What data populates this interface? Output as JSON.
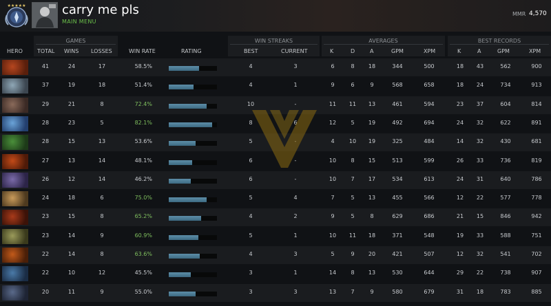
{
  "player": {
    "name": "carry me pls",
    "subtitle": "MAIN MENU",
    "mmr_label": "MMR",
    "mmr_value": "4,570"
  },
  "groups": {
    "games": "GAMES",
    "win_streaks": "WIN STREAKS",
    "averages": "AVERAGES",
    "best_records": "BEST RECORDS"
  },
  "columns": {
    "hero": "HERO",
    "total": "TOTAL",
    "wins": "WINS",
    "losses": "LOSSES",
    "win_rate": "WIN RATE",
    "rating": "RATING",
    "best": "BEST",
    "current": "CURRENT",
    "avg_k": "K",
    "avg_d": "D",
    "avg_a": "A",
    "avg_gpm": "GPM",
    "avg_xpm": "XPM",
    "best_k": "K",
    "best_a": "A",
    "best_gpm": "GPM",
    "best_xpm": "XPM"
  },
  "colors": {
    "win_rate_high": "#7fbf5e",
    "win_rate_low": "#c9ccd0",
    "rating_fill": "#4e7d96",
    "mmr_accent": "#6bbf4a"
  },
  "rows": [
    {
      "total": "41",
      "wins": "24",
      "losses": "17",
      "win_rate": "58.5%",
      "rating": 0.63,
      "best": "4",
      "current": "3",
      "k": "6",
      "d": "8",
      "a": "18",
      "gpm": "344",
      "xpm": "500",
      "bk": "18",
      "ba": "43",
      "bgpm": "562",
      "bxpm": "900"
    },
    {
      "total": "37",
      "wins": "19",
      "losses": "18",
      "win_rate": "51.4%",
      "rating": 0.52,
      "best": "4",
      "current": "1",
      "k": "9",
      "d": "6",
      "a": "9",
      "gpm": "568",
      "xpm": "658",
      "bk": "18",
      "ba": "24",
      "bgpm": "734",
      "bxpm": "913"
    },
    {
      "total": "29",
      "wins": "21",
      "losses": "8",
      "win_rate": "72.4%",
      "rating": 0.78,
      "best": "10",
      "current": "-",
      "k": "11",
      "d": "11",
      "a": "13",
      "gpm": "461",
      "xpm": "594",
      "bk": "23",
      "ba": "37",
      "bgpm": "604",
      "bxpm": "814"
    },
    {
      "total": "28",
      "wins": "23",
      "losses": "5",
      "win_rate": "82.1%",
      "rating": 0.9,
      "best": "8",
      "current": "6",
      "k": "12",
      "d": "5",
      "a": "19",
      "gpm": "492",
      "xpm": "694",
      "bk": "24",
      "ba": "32",
      "bgpm": "622",
      "bxpm": "891"
    },
    {
      "total": "28",
      "wins": "15",
      "losses": "13",
      "win_rate": "53.6%",
      "rating": 0.55,
      "best": "5",
      "current": "-",
      "k": "4",
      "d": "10",
      "a": "19",
      "gpm": "325",
      "xpm": "484",
      "bk": "14",
      "ba": "32",
      "bgpm": "430",
      "bxpm": "681"
    },
    {
      "total": "27",
      "wins": "13",
      "losses": "14",
      "win_rate": "48.1%",
      "rating": 0.48,
      "best": "6",
      "current": "-",
      "k": "10",
      "d": "8",
      "a": "15",
      "gpm": "513",
      "xpm": "599",
      "bk": "26",
      "ba": "33",
      "bgpm": "736",
      "bxpm": "819"
    },
    {
      "total": "26",
      "wins": "12",
      "losses": "14",
      "win_rate": "46.2%",
      "rating": 0.46,
      "best": "6",
      "current": "-",
      "k": "10",
      "d": "7",
      "a": "17",
      "gpm": "534",
      "xpm": "613",
      "bk": "24",
      "ba": "31",
      "bgpm": "640",
      "bxpm": "786"
    },
    {
      "total": "24",
      "wins": "18",
      "losses": "6",
      "win_rate": "75.0%",
      "rating": 0.78,
      "best": "5",
      "current": "4",
      "k": "7",
      "d": "5",
      "a": "13",
      "gpm": "455",
      "xpm": "566",
      "bk": "12",
      "ba": "22",
      "bgpm": "577",
      "bxpm": "778"
    },
    {
      "total": "23",
      "wins": "15",
      "losses": "8",
      "win_rate": "65.2%",
      "rating": 0.67,
      "best": "4",
      "current": "2",
      "k": "9",
      "d": "5",
      "a": "8",
      "gpm": "629",
      "xpm": "686",
      "bk": "21",
      "ba": "15",
      "bgpm": "846",
      "bxpm": "942"
    },
    {
      "total": "23",
      "wins": "14",
      "losses": "9",
      "win_rate": "60.9%",
      "rating": 0.62,
      "best": "5",
      "current": "1",
      "k": "10",
      "d": "11",
      "a": "18",
      "gpm": "371",
      "xpm": "548",
      "bk": "19",
      "ba": "33",
      "bgpm": "588",
      "bxpm": "751"
    },
    {
      "total": "22",
      "wins": "14",
      "losses": "8",
      "win_rate": "63.6%",
      "rating": 0.64,
      "best": "4",
      "current": "3",
      "k": "5",
      "d": "9",
      "a": "20",
      "gpm": "421",
      "xpm": "507",
      "bk": "12",
      "ba": "32",
      "bgpm": "541",
      "bxpm": "702"
    },
    {
      "total": "22",
      "wins": "10",
      "losses": "12",
      "win_rate": "45.5%",
      "rating": 0.45,
      "best": "3",
      "current": "1",
      "k": "14",
      "d": "8",
      "a": "13",
      "gpm": "530",
      "xpm": "644",
      "bk": "29",
      "ba": "22",
      "bgpm": "738",
      "bxpm": "907"
    },
    {
      "total": "20",
      "wins": "11",
      "losses": "9",
      "win_rate": "55.0%",
      "rating": 0.55,
      "best": "3",
      "current": "3",
      "k": "13",
      "d": "7",
      "a": "9",
      "gpm": "580",
      "xpm": "679",
      "bk": "31",
      "ba": "18",
      "bgpm": "783",
      "bxpm": "885"
    }
  ]
}
